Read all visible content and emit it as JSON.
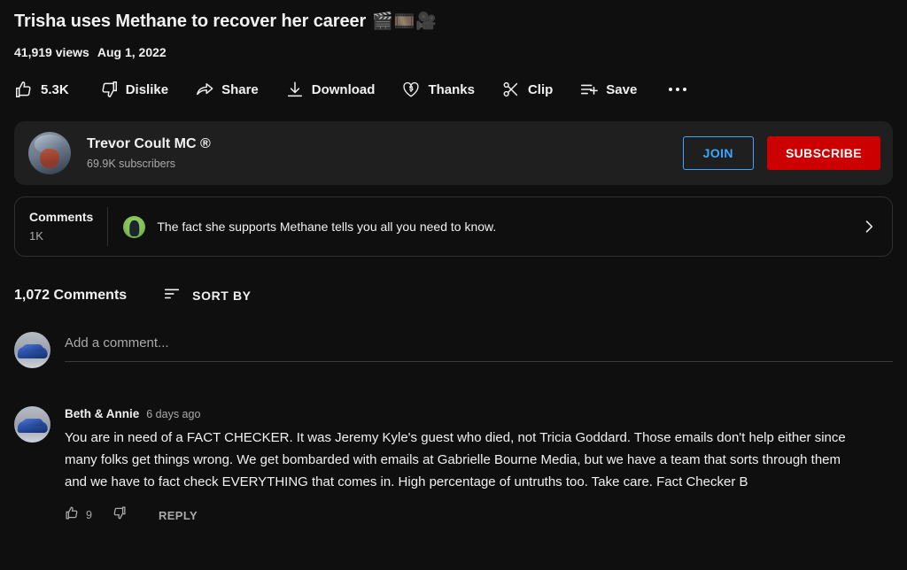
{
  "video": {
    "title": "Trisha uses Methane to recover her career",
    "title_emojis": [
      "🎬",
      "🎞️",
      "🎥"
    ],
    "views": "41,919 views",
    "publish_date": "Aug 1, 2022"
  },
  "actions": {
    "like": {
      "label": "5.3K",
      "icon": "thumbs-up-icon"
    },
    "dislike": {
      "label": "Dislike",
      "icon": "thumbs-down-icon"
    },
    "share": {
      "label": "Share",
      "icon": "share-arrow-icon"
    },
    "download": {
      "label": "Download",
      "icon": "download-icon"
    },
    "thanks": {
      "label": "Thanks",
      "icon": "heart-dollar-icon"
    },
    "clip": {
      "label": "Clip",
      "icon": "scissors-icon"
    },
    "save": {
      "label": "Save",
      "icon": "save-playlist-icon"
    },
    "more": {
      "label": "",
      "icon": "more-horizontal-icon"
    }
  },
  "channel": {
    "name": "Trevor Coult MC ®",
    "subscribers": "69.9K subscribers",
    "avatar_icon": "channel-avatar-helmet",
    "join_label": "JOIN",
    "subscribe_label": "SUBSCRIBE",
    "join_color": "#3ea6ff",
    "subscribe_color": "#cc0000"
  },
  "comments_preview": {
    "label": "Comments",
    "count": "1K",
    "top_comment": "The fact she supports Methane tells you all you need to know.",
    "avatar_icon": "preview-avatar-green",
    "chevron_icon": "chevron-right-icon"
  },
  "comments_section": {
    "count_label": "1,072 Comments",
    "sort_label": "SORT BY",
    "sort_icon": "sort-lines-icon",
    "add_comment_placeholder": "Add a comment...",
    "add_comment_value": "",
    "user_avatar_icon": "user-avatar-blue-car"
  },
  "comments": [
    {
      "author": "Beth & Annie",
      "time": "6 days ago",
      "avatar_icon": "commenter-avatar-blue-car",
      "text": "You are in need of a FACT CHECKER. It was Jeremy Kyle's guest who died, not Tricia Goddard. Those emails don't help either since many folks get things wrong. We get bombarded with emails at Gabrielle Bourne Media, but we have a team that sorts through them and we have to fact check EVERYTHING that comes in. High percentage of untruths too. Take care. Fact Checker B",
      "likes": "9",
      "reply_label": "REPLY"
    }
  ],
  "theme": {
    "background": "#0f0f0f",
    "card_background": "#1f1f1f",
    "text_primary": "#f1f1f1",
    "text_secondary": "#aaaaaa",
    "border": "#303030"
  }
}
